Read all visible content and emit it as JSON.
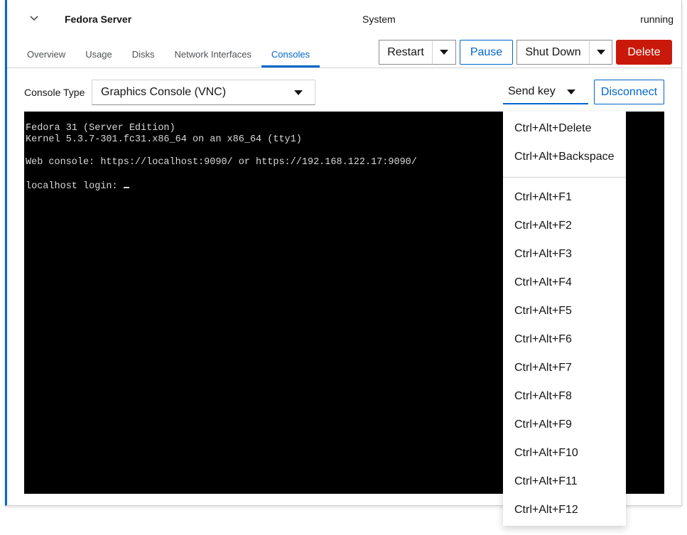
{
  "vm": {
    "name": "Fedora Server",
    "connection": "System",
    "state": "running"
  },
  "tabs": [
    {
      "label": "Overview"
    },
    {
      "label": "Usage"
    },
    {
      "label": "Disks"
    },
    {
      "label": "Network Interfaces"
    },
    {
      "label": "Consoles"
    }
  ],
  "active_tab": "Consoles",
  "actions": {
    "restart": "Restart",
    "pause": "Pause",
    "shutdown": "Shut Down",
    "delete": "Delete"
  },
  "console": {
    "type_label": "Console Type",
    "type_value": "Graphics Console (VNC)",
    "send_key": "Send key",
    "disconnect": "Disconnect",
    "screen_lines": [
      "Fedora 31 (Server Edition)",
      "Kernel 5.3.7-301.fc31.x86_64 on an x86_64 (tty1)",
      "",
      "Web console: https://localhost:9090/ or https://192.168.122.17:9090/",
      "",
      "localhost login: "
    ]
  },
  "send_key_menu": {
    "group1": [
      "Ctrl+Alt+Delete",
      "Ctrl+Alt+Backspace"
    ],
    "group2": [
      "Ctrl+Alt+F1",
      "Ctrl+Alt+F2",
      "Ctrl+Alt+F3",
      "Ctrl+Alt+F4",
      "Ctrl+Alt+F5",
      "Ctrl+Alt+F6",
      "Ctrl+Alt+F7",
      "Ctrl+Alt+F8",
      "Ctrl+Alt+F9",
      "Ctrl+Alt+F10",
      "Ctrl+Alt+F11",
      "Ctrl+Alt+F12"
    ]
  },
  "icons": {
    "expand": "chevron-down-icon",
    "dropdown": "caret-down-icon"
  },
  "colors": {
    "primary": "#0066cc",
    "danger": "#c9190b",
    "console_bg": "#000000"
  }
}
